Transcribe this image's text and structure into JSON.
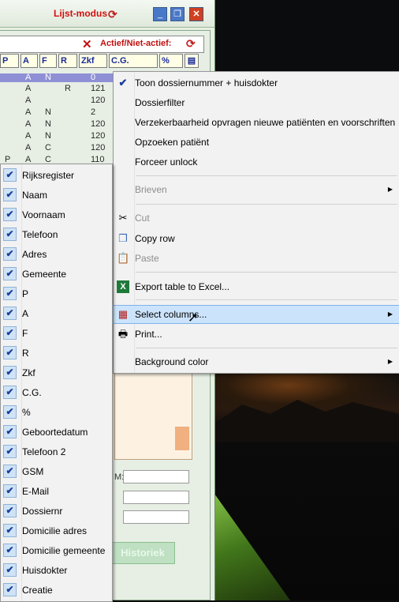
{
  "window": {
    "mode_label": "Lijst-modus",
    "minimize": "_",
    "restore": "❐",
    "close": "✕"
  },
  "filter": {
    "label": "Actief/Niet-actief:",
    "x": "✕"
  },
  "columns_header": [
    "P",
    "A",
    "F",
    "R",
    "Zkf",
    "C.G.",
    "%"
  ],
  "rows": [
    {
      "a": "A",
      "f": "N",
      "r": "",
      "zkf": "0",
      "p": ""
    },
    {
      "a": "A",
      "f": "",
      "r": "R",
      "zkf": "121",
      "p": ""
    },
    {
      "a": "A",
      "f": "",
      "r": "",
      "zkf": "120",
      "p": ""
    },
    {
      "a": "A",
      "f": "N",
      "r": "",
      "zkf": "2",
      "p": ""
    },
    {
      "a": "A",
      "f": "N",
      "r": "",
      "zkf": "120",
      "p": ""
    },
    {
      "a": "A",
      "f": "N",
      "r": "",
      "zkf": "120",
      "p": ""
    },
    {
      "a": "A",
      "f": "C",
      "r": "",
      "zkf": "120",
      "p": ""
    },
    {
      "a": "A",
      "f": "C",
      "r": "",
      "zkf": "110",
      "p": "P"
    }
  ],
  "lower": {
    "field_label": "M:",
    "history_button": "Historiek"
  },
  "context_menu": {
    "items": [
      {
        "label": "Toon dossiernummer + huisdokter",
        "checked": true
      },
      {
        "label": "Dossierfilter"
      },
      {
        "label": "Verzekerbaarheid opvragen nieuwe patiënten en voorschriften"
      },
      {
        "label": "Opzoeken patiënt"
      },
      {
        "label": "Forceer unlock"
      },
      {
        "label": "Brieven",
        "disabled": true,
        "submenu": true
      },
      {
        "label": "Cut",
        "disabled": true,
        "icon": "scissors-icon"
      },
      {
        "label": "Copy row",
        "icon": "copy-icon"
      },
      {
        "label": "Paste",
        "disabled": true,
        "icon": "paste-icon"
      },
      {
        "label": "Export table to Excel...",
        "icon": "excel-icon"
      },
      {
        "label": "Select columns...",
        "icon": "columns-icon",
        "submenu": true,
        "highlighted": true
      },
      {
        "label": "Print...",
        "icon": "printer-icon"
      },
      {
        "label": "Background color",
        "submenu": true
      }
    ]
  },
  "columns_menu": {
    "items": [
      "Rijksregister",
      "Naam",
      "Voornaam",
      "Telefoon",
      "Adres",
      "Gemeente",
      "P",
      "A",
      "F",
      "R",
      "Zkf",
      "C.G.",
      "%",
      "Geboortedatum",
      "Telefoon 2",
      "GSM",
      "E-Mail",
      "Dossiernr",
      "Domicilie adres",
      "Domicilie gemeente",
      "Huisdokter",
      "Creatie"
    ]
  }
}
